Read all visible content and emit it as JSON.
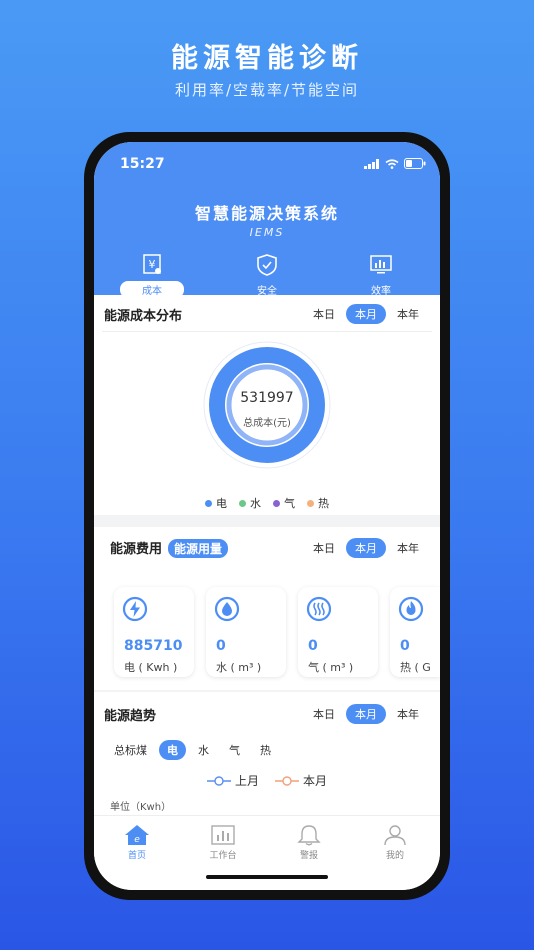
{
  "promo": {
    "title": "能源智能诊断",
    "subtitle": "利用率/空载率/节能空间"
  },
  "status_bar": {
    "time": "15:27"
  },
  "app": {
    "title": "智慧能源决策系统",
    "subtitle": "IEMS"
  },
  "top_tabs": [
    {
      "label": "成本",
      "icon": "yen-icon",
      "active": true
    },
    {
      "label": "安全",
      "icon": "shield-check-icon",
      "active": false
    },
    {
      "label": "效率",
      "icon": "monitor-chart-icon",
      "active": false
    }
  ],
  "cost_section": {
    "title": "能源成本分布",
    "periods": [
      "本日",
      "本月",
      "本年"
    ],
    "selected_period": "本月",
    "total_value": "531997",
    "total_label": "总成本(元)",
    "legend": [
      {
        "label": "电",
        "color": "#4d8ef5"
      },
      {
        "label": "水",
        "color": "#6cc788"
      },
      {
        "label": "气",
        "color": "#8a63d2"
      },
      {
        "label": "热",
        "color": "#f3b27d"
      }
    ]
  },
  "fee_section": {
    "title": "能源费用",
    "alt_tab": "能源用量",
    "periods": [
      "本日",
      "本月",
      "本年"
    ],
    "selected_period": "本月",
    "cards": [
      {
        "icon": "lightning-icon",
        "value": "885710",
        "unit": "电 ( Kwh )"
      },
      {
        "icon": "water-drop-icon",
        "value": "0",
        "unit": "水 ( m³ )"
      },
      {
        "icon": "gas-waves-icon",
        "value": "0",
        "unit": "气 ( m³ )"
      },
      {
        "icon": "flame-icon",
        "value": "0",
        "unit": "热 ( G"
      }
    ]
  },
  "trend_section": {
    "title": "能源趋势",
    "periods": [
      "本日",
      "本月",
      "本年"
    ],
    "selected_period": "本月",
    "categories": [
      "总标煤",
      "电",
      "水",
      "气",
      "热"
    ],
    "selected_category": "电",
    "lines": [
      {
        "label": "上月",
        "color": "#5b8ef0"
      },
      {
        "label": "本月",
        "color": "#f3a07a"
      }
    ],
    "unit_label": "单位（Kwh）"
  },
  "bottom_nav": [
    {
      "label": "首页",
      "icon": "home-icon",
      "active": true
    },
    {
      "label": "工作台",
      "icon": "workbench-icon",
      "active": false
    },
    {
      "label": "警报",
      "icon": "bell-icon",
      "active": false
    },
    {
      "label": "我的",
      "icon": "user-icon",
      "active": false
    }
  ],
  "colors": {
    "accent": "#4d8ef5",
    "background_top": "#4a9af5",
    "background_bottom": "#2a56e6"
  }
}
